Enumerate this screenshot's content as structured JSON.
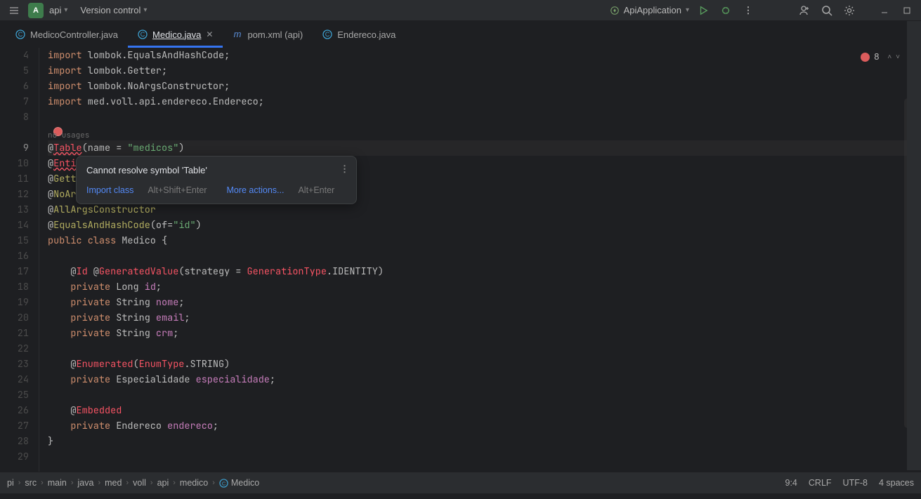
{
  "toolbar": {
    "project_letter": "A",
    "project_name": "api",
    "version_control": "Version control",
    "run_config": "ApiApplication"
  },
  "tabs": [
    {
      "label": "MedicoController.java",
      "icon": "class"
    },
    {
      "label": "Medico.java",
      "icon": "class",
      "active": true,
      "closable": true
    },
    {
      "label": "pom.xml (api)",
      "icon": "maven"
    },
    {
      "label": "Endereco.java",
      "icon": "class"
    }
  ],
  "inspections": {
    "error_count": "8"
  },
  "hint": {
    "title": "Cannot resolve symbol 'Table'",
    "action1": "Import class",
    "action1_hint": "Alt+Shift+Enter",
    "action2": "More actions...",
    "action2_hint": "Alt+Enter"
  },
  "code_lines": [
    {
      "n": "4",
      "tokens": [
        {
          "t": "import",
          "c": "kw"
        },
        {
          "t": " lombok.",
          "c": "txt"
        },
        {
          "t": "EqualsAndHashCode",
          "c": "txt"
        },
        {
          "t": ";",
          "c": "txt"
        }
      ]
    },
    {
      "n": "5",
      "tokens": [
        {
          "t": "import",
          "c": "kw"
        },
        {
          "t": " lombok.",
          "c": "txt"
        },
        {
          "t": "Getter",
          "c": "txt"
        },
        {
          "t": ";",
          "c": "txt"
        }
      ]
    },
    {
      "n": "6",
      "tokens": [
        {
          "t": "import",
          "c": "kw"
        },
        {
          "t": " lombok.",
          "c": "txt"
        },
        {
          "t": "NoArgsConstructor",
          "c": "txt"
        },
        {
          "t": ";",
          "c": "txt"
        }
      ]
    },
    {
      "n": "7",
      "tokens": [
        {
          "t": "import",
          "c": "kw"
        },
        {
          "t": " med.voll.api.endereco.Endereco;",
          "c": "txt"
        }
      ]
    },
    {
      "n": "8",
      "tokens": []
    },
    {
      "n": "",
      "usages": "no usages"
    },
    {
      "n": "9",
      "caret": true,
      "tokens": [
        {
          "t": "@",
          "c": "txt"
        },
        {
          "t": "Table",
          "c": "annerr",
          "wavy": true
        },
        {
          "t": "(name = ",
          "c": "txt"
        },
        {
          "t": "\"medicos\"",
          "c": "str"
        },
        {
          "t": ")",
          "c": "txt"
        }
      ]
    },
    {
      "n": "10",
      "tokens": [
        {
          "t": "@",
          "c": "txt"
        },
        {
          "t": "Enti",
          "c": "annerr",
          "wavy": true
        }
      ]
    },
    {
      "n": "11",
      "tokens": [
        {
          "t": "@",
          "c": "txt"
        },
        {
          "t": "Gett",
          "c": "ann"
        }
      ]
    },
    {
      "n": "12",
      "tokens": [
        {
          "t": "@",
          "c": "txt"
        },
        {
          "t": "NoAr",
          "c": "ann"
        }
      ]
    },
    {
      "n": "13",
      "tokens": [
        {
          "t": "@",
          "c": "txt"
        },
        {
          "t": "AllArgsConstructor",
          "c": "ann"
        }
      ]
    },
    {
      "n": "14",
      "tokens": [
        {
          "t": "@",
          "c": "txt"
        },
        {
          "t": "EqualsAndHashCode",
          "c": "ann"
        },
        {
          "t": "(of=",
          "c": "txt"
        },
        {
          "t": "\"id\"",
          "c": "str"
        },
        {
          "t": ")",
          "c": "txt"
        }
      ]
    },
    {
      "n": "15",
      "tokens": [
        {
          "t": "public class",
          "c": "kw"
        },
        {
          "t": " Medico {",
          "c": "cls"
        }
      ]
    },
    {
      "n": "16",
      "tokens": []
    },
    {
      "n": "17",
      "tokens": [
        {
          "t": "    @",
          "c": "txt"
        },
        {
          "t": "Id",
          "c": "annerr"
        },
        {
          "t": " @",
          "c": "txt"
        },
        {
          "t": "GeneratedValue",
          "c": "annerr"
        },
        {
          "t": "(strategy = ",
          "c": "txt"
        },
        {
          "t": "GenerationType",
          "c": "annerr"
        },
        {
          "t": ".IDENTITY)",
          "c": "txt"
        }
      ]
    },
    {
      "n": "18",
      "tokens": [
        {
          "t": "    ",
          "c": "txt"
        },
        {
          "t": "private",
          "c": "kw"
        },
        {
          "t": " Long ",
          "c": "txt"
        },
        {
          "t": "id",
          "c": "fld"
        },
        {
          "t": ";",
          "c": "txt"
        }
      ]
    },
    {
      "n": "19",
      "tokens": [
        {
          "t": "    ",
          "c": "txt"
        },
        {
          "t": "private",
          "c": "kw"
        },
        {
          "t": " String ",
          "c": "txt"
        },
        {
          "t": "nome",
          "c": "fld"
        },
        {
          "t": ";",
          "c": "txt"
        }
      ]
    },
    {
      "n": "20",
      "tokens": [
        {
          "t": "    ",
          "c": "txt"
        },
        {
          "t": "private",
          "c": "kw"
        },
        {
          "t": " String ",
          "c": "txt"
        },
        {
          "t": "email",
          "c": "fld"
        },
        {
          "t": ";",
          "c": "txt"
        }
      ]
    },
    {
      "n": "21",
      "tokens": [
        {
          "t": "    ",
          "c": "txt"
        },
        {
          "t": "private",
          "c": "kw"
        },
        {
          "t": " String ",
          "c": "txt"
        },
        {
          "t": "crm",
          "c": "fld"
        },
        {
          "t": ";",
          "c": "txt"
        }
      ]
    },
    {
      "n": "22",
      "tokens": []
    },
    {
      "n": "23",
      "tokens": [
        {
          "t": "    @",
          "c": "txt"
        },
        {
          "t": "Enumerated",
          "c": "annerr"
        },
        {
          "t": "(",
          "c": "txt"
        },
        {
          "t": "EnumType",
          "c": "annerr"
        },
        {
          "t": ".STRING)",
          "c": "txt"
        }
      ]
    },
    {
      "n": "24",
      "tokens": [
        {
          "t": "    ",
          "c": "txt"
        },
        {
          "t": "private",
          "c": "kw"
        },
        {
          "t": " Especialidade ",
          "c": "txt"
        },
        {
          "t": "especialidade",
          "c": "fld"
        },
        {
          "t": ";",
          "c": "txt"
        }
      ]
    },
    {
      "n": "25",
      "tokens": []
    },
    {
      "n": "26",
      "tokens": [
        {
          "t": "    @",
          "c": "txt"
        },
        {
          "t": "Embedded",
          "c": "annerr"
        }
      ]
    },
    {
      "n": "27",
      "tokens": [
        {
          "t": "    ",
          "c": "txt"
        },
        {
          "t": "private",
          "c": "kw"
        },
        {
          "t": " Endereco ",
          "c": "txt"
        },
        {
          "t": "endereco",
          "c": "fld"
        },
        {
          "t": ";",
          "c": "txt"
        }
      ]
    },
    {
      "n": "28",
      "tokens": [
        {
          "t": "}",
          "c": "txt"
        }
      ]
    },
    {
      "n": "29",
      "tokens": []
    }
  ],
  "breadcrumb": [
    "pi",
    "src",
    "main",
    "java",
    "med",
    "voll",
    "api",
    "medico",
    "Medico"
  ],
  "status": {
    "pos": "9:4",
    "sep": "CRLF",
    "enc": "UTF-8",
    "indent": "4 spaces"
  },
  "markers": [
    148,
    156,
    164,
    180,
    320,
    420,
    452,
    522
  ]
}
